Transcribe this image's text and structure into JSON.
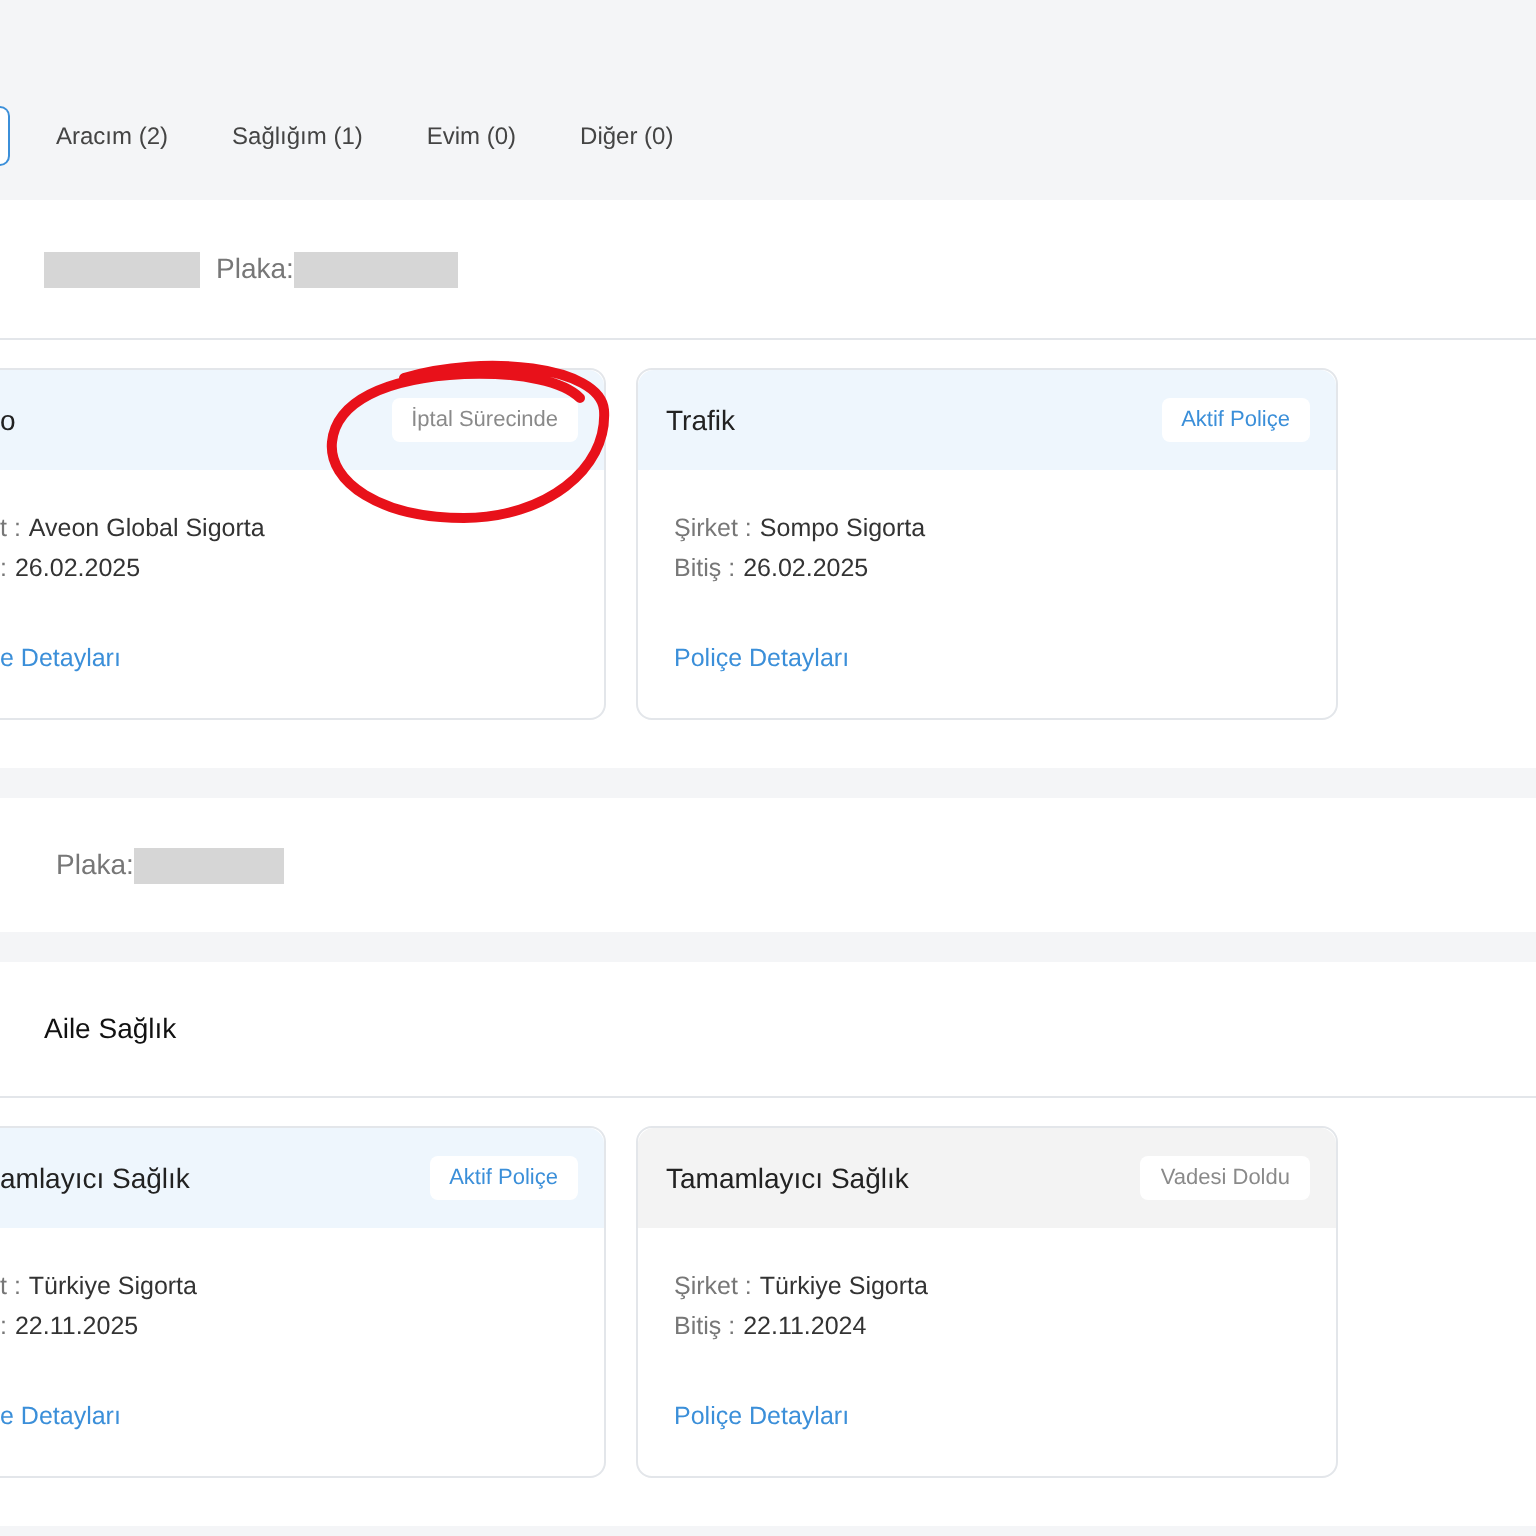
{
  "tabs": [
    {
      "selected": true
    },
    {
      "label": "Aracım (2)",
      "selected": false
    },
    {
      "label": "Sağlığım (1)",
      "selected": false
    },
    {
      "label": "Evim (0)",
      "selected": false
    },
    {
      "label": "Diğer (0)",
      "selected": false
    }
  ],
  "sections": [
    {
      "kind": "vehicle",
      "name_redacted": true,
      "plate_label": "Plaka:",
      "policies": [
        {
          "title": "o",
          "status": "İptal Sürecinde",
          "kind": "cancelling",
          "marked": true,
          "cut": true,
          "company_label": "t :",
          "company": "Aveon Global Sigorta",
          "end_label": ":",
          "end_date": "26.02.2025",
          "link": "e Detayları"
        },
        {
          "title": "Trafik",
          "status": "Aktif Poliçe",
          "kind": "active",
          "marked": false,
          "cut": false,
          "company_label": "Şirket :",
          "company": "Sompo Sigorta",
          "end_label": "Bitiş :",
          "end_date": "26.02.2025",
          "link": "Poliçe Detayları"
        }
      ]
    },
    {
      "kind": "vehicle",
      "name_redacted": false,
      "plate_label": "Plaka:"
    },
    {
      "kind": "health",
      "title": "Aile Sağlık",
      "policies": [
        {
          "title": "amlayıcı Sağlık",
          "status": "Aktif Poliçe",
          "kind": "active",
          "marked": false,
          "cut": true,
          "company_label": "t :",
          "company": "Türkiye Sigorta",
          "end_label": ":",
          "end_date": "22.11.2025",
          "link": "e Detayları"
        },
        {
          "title": "Tamamlayıcı Sağlık",
          "status": "Vadesi Doldu",
          "kind": "expired",
          "marked": false,
          "cut": false,
          "company_label": "Şirket :",
          "company": "Türkiye Sigorta",
          "end_label": "Bitiş :",
          "end_date": "22.11.2024",
          "link": "Poliçe Detayları"
        }
      ]
    }
  ]
}
